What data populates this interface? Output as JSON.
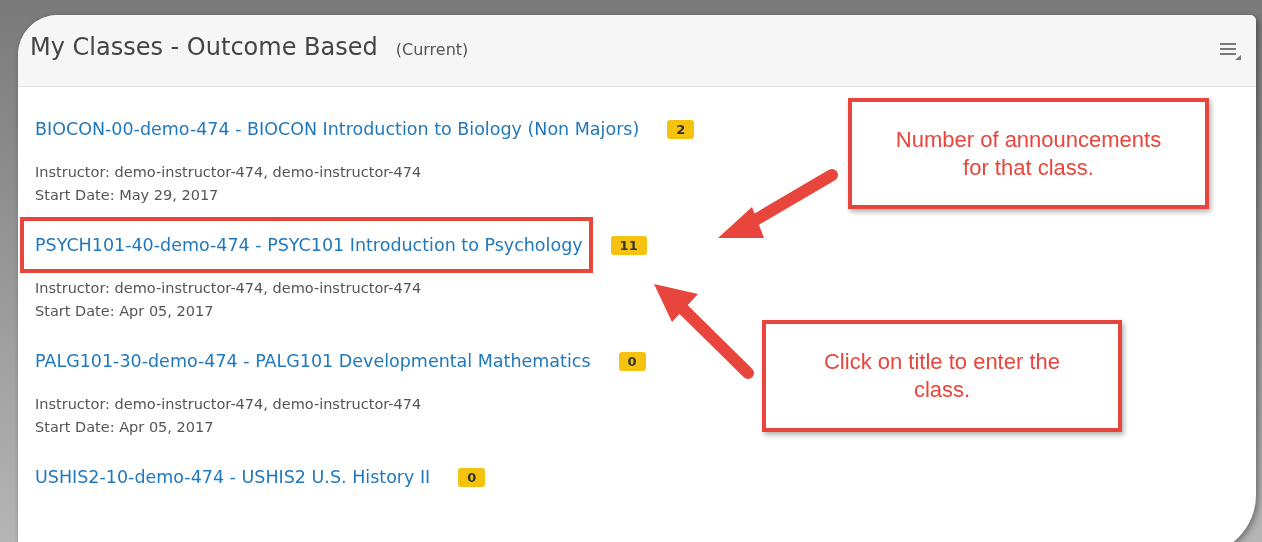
{
  "panel": {
    "title": "My Classes - Outcome Based",
    "subtitle": "(Current)"
  },
  "classes": [
    {
      "title": "BIOCON-00-demo-474 - BIOCON Introduction to Biology (Non Majors)",
      "announcements": "2",
      "instructor": "Instructor: demo-instructor-474, demo-instructor-474",
      "start_date": "Start Date: May 29, 2017",
      "highlighted": false
    },
    {
      "title": "PSYCH101-40-demo-474 - PSYC101 Introduction to Psychology",
      "announcements": "11",
      "instructor": "Instructor: demo-instructor-474, demo-instructor-474",
      "start_date": "Start Date: Apr 05, 2017",
      "highlighted": true
    },
    {
      "title": "PALG101-30-demo-474 - PALG101 Developmental Mathematics",
      "announcements": "0",
      "instructor": "Instructor: demo-instructor-474, demo-instructor-474",
      "start_date": "Start Date: Apr 05, 2017",
      "highlighted": false
    },
    {
      "title": "USHIS2-10-demo-474 - USHIS2 U.S. History II",
      "announcements": "0",
      "highlighted": false
    }
  ],
  "callouts": [
    {
      "text": "Number of announcements for that class."
    },
    {
      "text": "Click on title to enter the class."
    }
  ]
}
